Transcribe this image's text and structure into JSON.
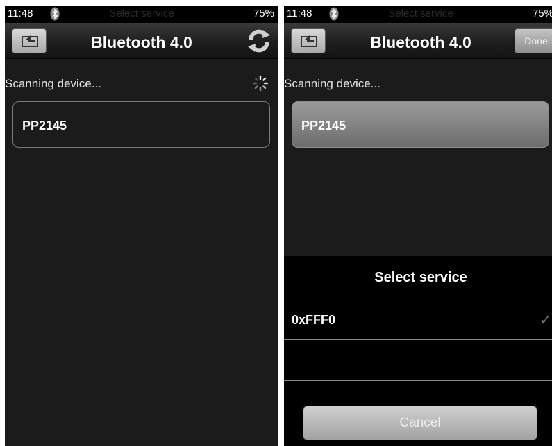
{
  "left_screen": {
    "status": {
      "time": "11:48",
      "overlay_title": "Select service",
      "battery": "75%"
    },
    "nav": {
      "title": "Bluetooth 4.0"
    },
    "scan_label": "Scanning device...",
    "devices": [
      {
        "name": "PP2145"
      }
    ]
  },
  "right_screen": {
    "status": {
      "time": "11:48",
      "overlay_title": "Select service",
      "battery": "75%"
    },
    "nav": {
      "title": "Bluetooth 4.0",
      "done_label": "Done"
    },
    "scan_label": "Scanning device...",
    "devices": [
      {
        "name": "PP2145",
        "selected": true
      }
    ],
    "service_sheet": {
      "title": "Select service",
      "services": [
        {
          "name": "0xFFF0",
          "checked": true
        }
      ],
      "check_glyph": "✓",
      "cancel_label": "Cancel"
    }
  }
}
